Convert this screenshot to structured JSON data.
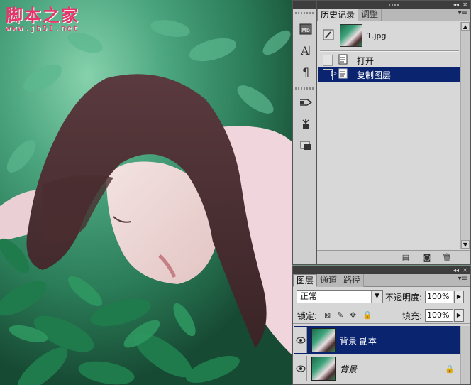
{
  "watermark": {
    "title": "脚本之家",
    "url": "www.jb51.net"
  },
  "history_panel": {
    "tabs": [
      "历史记录",
      "调整"
    ],
    "snapshot": {
      "name": "1.jpg"
    },
    "states": [
      {
        "label": "打开",
        "selected": false
      },
      {
        "label": "复制图层",
        "selected": true
      }
    ]
  },
  "layers_panel": {
    "tabs": [
      "图层",
      "通道",
      "路径"
    ],
    "blend_mode": "正常",
    "opacity_label": "不透明度:",
    "opacity_value": "100%",
    "lock_label": "锁定:",
    "fill_label": "填充:",
    "fill_value": "100%",
    "layers": [
      {
        "name": "背景 副本",
        "selected": true
      },
      {
        "name": "背景",
        "selected": false,
        "locked": true
      }
    ]
  },
  "colors": {
    "selection": "#0b2470",
    "watermark": "#e8336b"
  }
}
